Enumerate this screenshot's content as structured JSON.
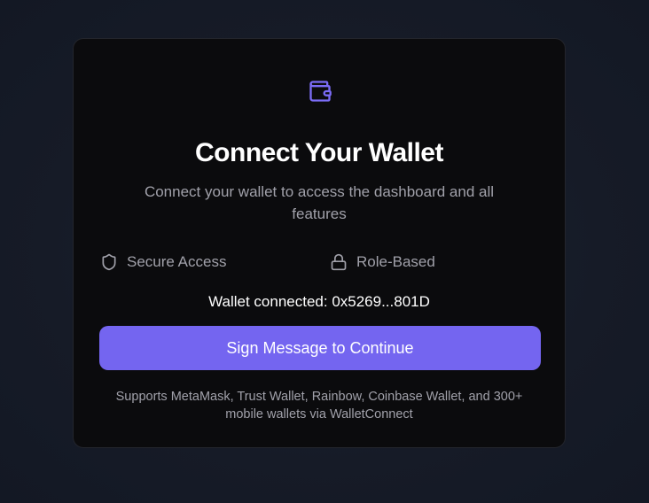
{
  "colors": {
    "page_background": "#161b27",
    "card_background": "#0b0b0d",
    "accent": "#7465f0",
    "muted_text": "#a1a1aa"
  },
  "card": {
    "icon": "wallet-icon",
    "title": "Connect Your Wallet",
    "subtitle": "Connect your wallet to access the dashboard and all features",
    "features": [
      {
        "icon": "shield-icon",
        "label": "Secure Access"
      },
      {
        "icon": "lock-icon",
        "label": "Role-Based"
      }
    ],
    "status": "Wallet connected: 0x5269...801D",
    "button_label": "Sign Message to Continue",
    "footer_note": "Supports MetaMask, Trust Wallet, Rainbow, Coinbase Wallet, and 300+ mobile wallets via WalletConnect"
  }
}
